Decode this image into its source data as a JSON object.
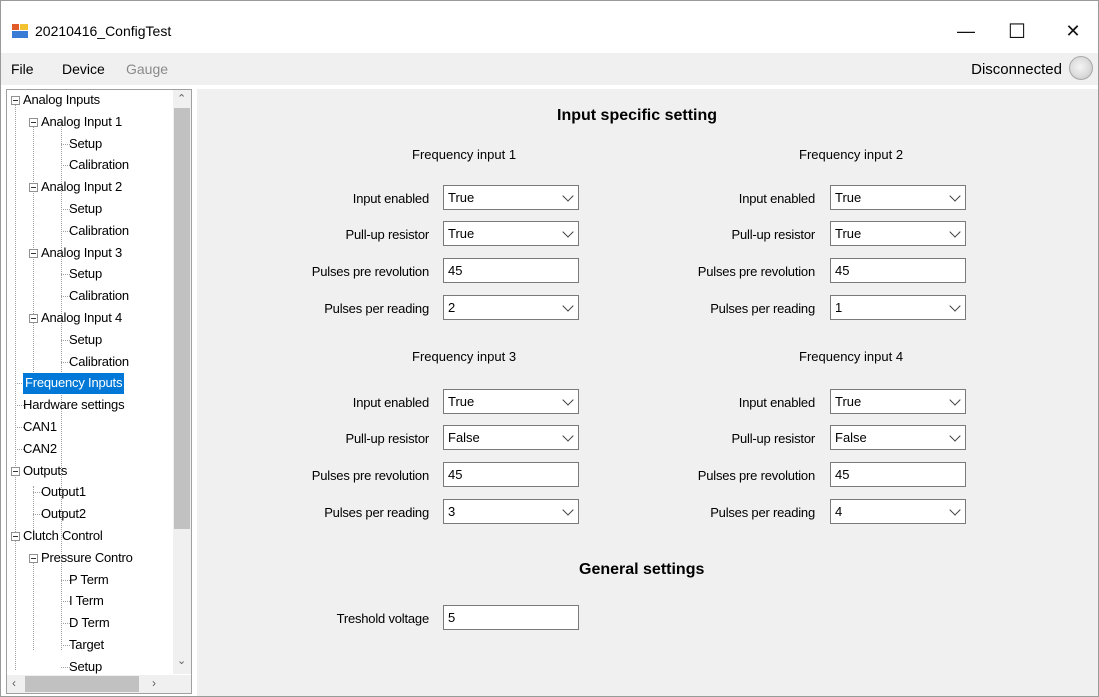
{
  "window": {
    "title": "20210416_ConfigTest",
    "controls": {
      "minimize": "—",
      "maximize": "☐",
      "close": "✕"
    }
  },
  "menu": {
    "items": [
      {
        "label": "File",
        "enabled": true
      },
      {
        "label": "Device",
        "enabled": true
      },
      {
        "label": "Gauge",
        "enabled": false
      }
    ],
    "status": "Disconnected"
  },
  "tree": {
    "nodes": [
      {
        "label": "Analog Inputs",
        "level": 0,
        "expanded": true
      },
      {
        "label": "Analog Input 1",
        "level": 1,
        "expanded": true
      },
      {
        "label": "Setup",
        "level": 2
      },
      {
        "label": "Calibration",
        "level": 2
      },
      {
        "label": "Analog Input 2",
        "level": 1,
        "expanded": true
      },
      {
        "label": "Setup",
        "level": 2
      },
      {
        "label": "Calibration",
        "level": 2
      },
      {
        "label": "Analog Input 3",
        "level": 1,
        "expanded": true
      },
      {
        "label": "Setup",
        "level": 2
      },
      {
        "label": "Calibration",
        "level": 2
      },
      {
        "label": "Analog Input 4",
        "level": 1,
        "expanded": true
      },
      {
        "label": "Setup",
        "level": 2
      },
      {
        "label": "Calibration",
        "level": 2
      },
      {
        "label": "Frequency Inputs",
        "level": 0,
        "selected": true
      },
      {
        "label": "Hardware settings",
        "level": 0
      },
      {
        "label": "CAN1",
        "level": 0
      },
      {
        "label": "CAN2",
        "level": 0
      },
      {
        "label": "Outputs",
        "level": 0,
        "expanded": true
      },
      {
        "label": "Output1",
        "level": 1
      },
      {
        "label": "Output2",
        "level": 1
      },
      {
        "label": "Clutch Control",
        "level": 0,
        "expanded": true
      },
      {
        "label": "Pressure Contro",
        "level": 1,
        "expanded": true
      },
      {
        "label": "P Term",
        "level": 2
      },
      {
        "label": "I Term",
        "level": 2
      },
      {
        "label": "D Term",
        "level": 2
      },
      {
        "label": "Target",
        "level": 2
      },
      {
        "label": "Setup",
        "level": 2
      }
    ]
  },
  "panel": {
    "heading": "Input specific setting",
    "labels": {
      "input_enabled": "Input enabled",
      "pullup": "Pull-up resistor",
      "pulses_rev": "Pulses pre revolution",
      "pulses_read": "Pulses per reading"
    },
    "groups": [
      {
        "title": "Frequency input 1",
        "input_enabled": "True",
        "pullup": "True",
        "pulses_rev": "45",
        "pulses_read": "2"
      },
      {
        "title": "Frequency input 2",
        "input_enabled": "True",
        "pullup": "True",
        "pulses_rev": "45",
        "pulses_read": "1"
      },
      {
        "title": "Frequency input 3",
        "input_enabled": "True",
        "pullup": "False",
        "pulses_rev": "45",
        "pulses_read": "3"
      },
      {
        "title": "Frequency input 4",
        "input_enabled": "True",
        "pullup": "False",
        "pulses_rev": "45",
        "pulses_read": "4"
      }
    ],
    "general": {
      "heading": "General settings",
      "threshold_label": "Treshold voltage",
      "threshold_value": "5"
    }
  }
}
